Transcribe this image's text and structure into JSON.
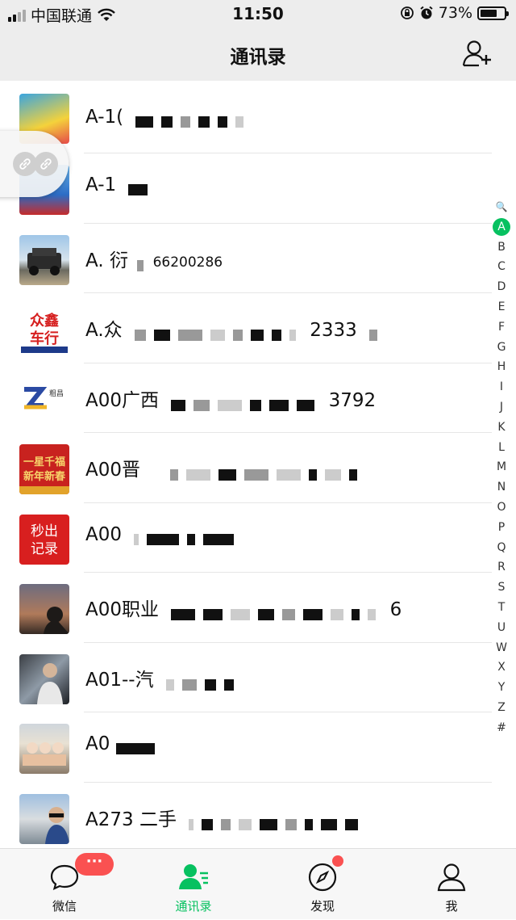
{
  "status_bar": {
    "carrier": "中国联通",
    "time": "11:50",
    "battery_percent": "73%",
    "battery_level": 0.73,
    "icons": [
      "signal-icon",
      "wifi-icon",
      "rotation-lock-icon",
      "alarm-icon",
      "battery-icon"
    ]
  },
  "nav": {
    "title": "通讯录",
    "add_friend_icon": "add-friend-icon"
  },
  "section": {
    "letter": "A"
  },
  "contacts": [
    {
      "name": "A-1("
    },
    {
      "name": "A-1"
    },
    {
      "name": "A. 衍",
      "suffix": "66200286"
    },
    {
      "name": "A.众",
      "suffix": "2333"
    },
    {
      "name": "A00广西",
      "suffix": "3792"
    },
    {
      "name": "A00晋"
    },
    {
      "name": "A00"
    },
    {
      "name": "A00职业",
      "suffix": "6"
    },
    {
      "name": "A01--汽"
    },
    {
      "name": "A0"
    },
    {
      "name": "A273 二手"
    }
  ],
  "avatars": {
    "a3_text": "众鑫车行",
    "a4_text": "粗昌",
    "a5_text": "一星千福 新年新春",
    "a6_text": "秒出记录"
  },
  "index_bar": [
    "🔍",
    "A",
    "B",
    "C",
    "D",
    "E",
    "F",
    "G",
    "H",
    "I",
    "J",
    "K",
    "L",
    "M",
    "N",
    "O",
    "P",
    "Q",
    "R",
    "S",
    "T",
    "U",
    "W",
    "X",
    "Y",
    "Z",
    "#"
  ],
  "tabs": [
    {
      "label": "微信",
      "icon": "chat-icon"
    },
    {
      "label": "通讯录",
      "icon": "contacts-icon"
    },
    {
      "label": "发现",
      "icon": "compass-icon"
    },
    {
      "label": "我",
      "icon": "profile-icon"
    }
  ],
  "badge_more": "···",
  "colors": {
    "accent": "#07c160",
    "badge": "#fa5151",
    "bar_bg": "#ededed"
  }
}
